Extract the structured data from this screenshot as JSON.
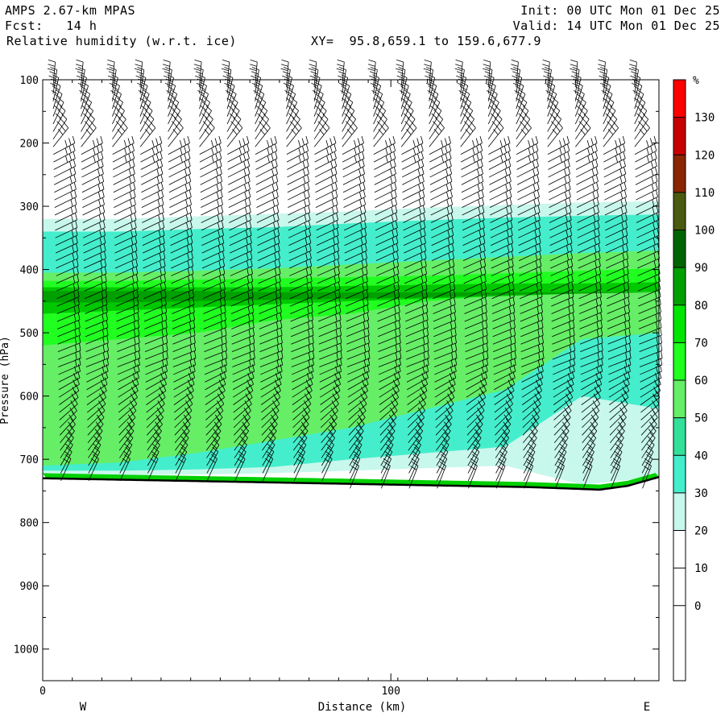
{
  "header": {
    "model": "AMPS 2.67-km MPAS",
    "forecast": "Fcst:   14 h",
    "field": "Relative humidity (w.r.t. ice)",
    "xy": "XY=  95.8,659.1 to 159.6,677.9",
    "init": "Init: 00 UTC Mon 01 Dec 25",
    "valid": "Valid: 14 UTC Mon 01 Dec 25"
  },
  "chart_data": {
    "type": "heatmap",
    "title": "Relative humidity (w.r.t. ice)",
    "xlabel": "Distance (km)",
    "ylabel": "Pressure (hPa)",
    "xlim": [
      0,
      177
    ],
    "ylim": [
      1050,
      100
    ],
    "x_ticks": [
      0,
      100
    ],
    "y_ticks": [
      100,
      200,
      300,
      400,
      500,
      600,
      700,
      800,
      900,
      1000
    ],
    "x_end_labels": {
      "left": "W",
      "right": "E"
    },
    "colorbar": {
      "unit": "%",
      "labels": [
        130,
        120,
        110,
        100,
        90,
        80,
        70,
        60,
        50,
        40,
        30,
        20,
        10,
        0
      ],
      "colors": [
        "#ff0000",
        "#c80000",
        "#8b2500",
        "#4a5a10",
        "#006400",
        "#00a000",
        "#00e600",
        "#20ff20",
        "#66ee66",
        "#33e099",
        "#44eecc",
        "#c8f7ec",
        "#ffffff",
        "#ffffff",
        "#ffffff",
        "#ffffff",
        "#ffffff"
      ]
    },
    "surface_pressure": {
      "x": [
        0,
        20,
        40,
        60,
        80,
        100,
        120,
        140,
        160,
        168,
        177
      ],
      "p": [
        730,
        732,
        734,
        736,
        738,
        740,
        742,
        744,
        748,
        742,
        728
      ]
    },
    "rh_layers": [
      {
        "name": "30-40%",
        "color": "#c8f7ec",
        "top": [
          320,
          320,
          316,
          312,
          308,
          302,
          298,
          294,
          292
        ],
        "bottom": [
          725,
          725,
          724,
          722,
          718,
          714,
          710,
          740,
          740
        ]
      },
      {
        "name": "40-50%",
        "color": "#44eecc",
        "top": [
          340,
          340,
          336,
          333,
          327,
          322,
          318,
          315,
          313
        ],
        "bottom": [
          718,
          718,
          716,
          712,
          700,
          690,
          680,
          600,
          620
        ]
      },
      {
        "name": "60-70%",
        "color": "#66ee66",
        "top": [
          405,
          405,
          402,
          398,
          392,
          386,
          380,
          374,
          370
        ],
        "bottom": [
          710,
          705,
          690,
          670,
          650,
          620,
          590,
          510,
          500
        ]
      },
      {
        "name": "70-80%",
        "color": "#20ff20",
        "top": [
          418,
          418,
          416,
          414,
          412,
          410,
          406,
          402,
          398
        ],
        "bottom": [
          520,
          510,
          500,
          480,
          470,
          450,
          440,
          430,
          425
        ]
      },
      {
        "name": "80-90%",
        "color": "#00c800",
        "top": [
          428,
          428,
          428,
          428,
          426,
          424,
          422,
          422,
          420
        ],
        "bottom": [
          470,
          465,
          460,
          455,
          450,
          446,
          442,
          438,
          435
        ]
      },
      {
        "name": "90-100%",
        "color": "#00a000",
        "top": [
          434,
          434,
          434,
          436,
          436,
          436,
          436,
          436,
          436
        ],
        "bottom": [
          452,
          452,
          450,
          448,
          446,
          444,
          440,
          438,
          436
        ]
      }
    ],
    "wind_barbs": {
      "x_columns_km": [
        3,
        11,
        20,
        28,
        36,
        45,
        53,
        61,
        70,
        78,
        86,
        95,
        103,
        111,
        120,
        128,
        136,
        145,
        153,
        161,
        170
      ],
      "levels_hPa_step": 12
    }
  }
}
